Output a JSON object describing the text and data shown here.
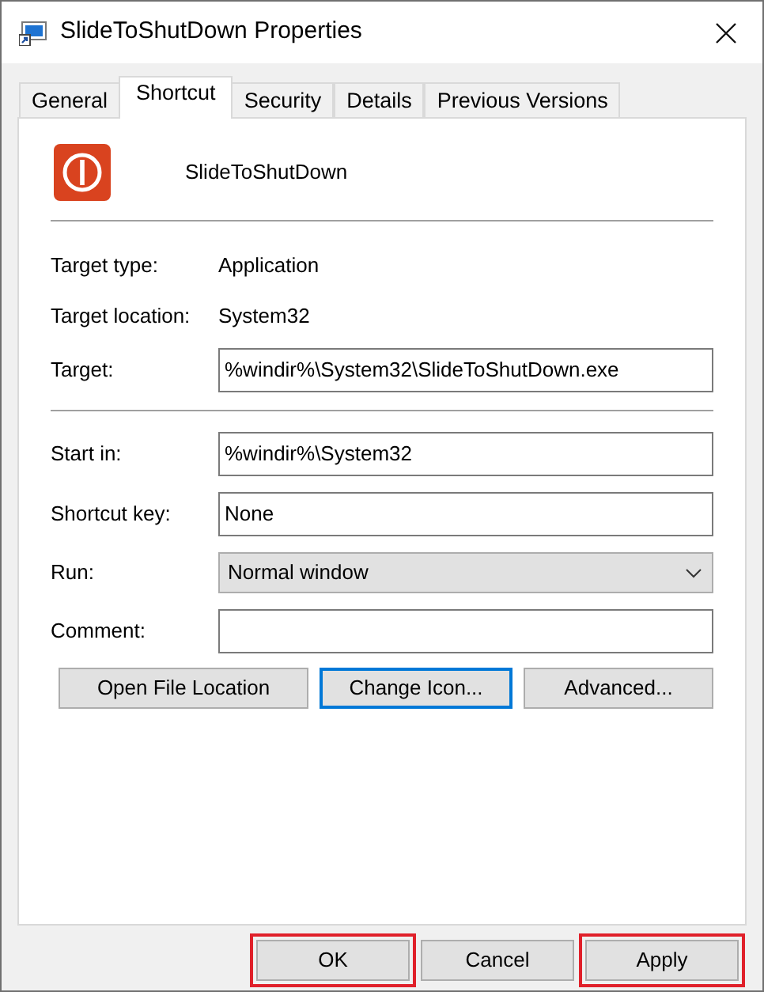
{
  "window": {
    "title": "SlideToShutDown Properties"
  },
  "tabs": [
    {
      "label": "General",
      "selected": false
    },
    {
      "label": "Shortcut",
      "selected": true
    },
    {
      "label": "Security",
      "selected": false
    },
    {
      "label": "Details",
      "selected": false
    },
    {
      "label": "Previous Versions",
      "selected": false
    }
  ],
  "shortcut_name": "SlideToShutDown",
  "info": [
    {
      "label": "Target type:",
      "value": "Application"
    },
    {
      "label": "Target location:",
      "value": "System32"
    }
  ],
  "target": {
    "label": "Target:",
    "value": "%windir%\\System32\\SlideToShutDown.exe"
  },
  "fields": [
    {
      "kind": "text",
      "label": "Start in:",
      "value": "%windir%\\System32"
    },
    {
      "kind": "text",
      "label": "Shortcut key:",
      "value": "None"
    },
    {
      "kind": "dropdown",
      "label": "Run:",
      "value": "Normal window"
    },
    {
      "kind": "text",
      "label": "Comment:"
    }
  ],
  "actions": [
    {
      "label": "Open File Location",
      "focused": false
    },
    {
      "label": "Change Icon...",
      "focused": true
    },
    {
      "label": "Advanced...",
      "focused": false
    }
  ],
  "buttons": [
    {
      "label": "OK",
      "highlighted": true
    },
    {
      "label": "Cancel",
      "highlighted": false
    },
    {
      "label": "Apply",
      "highlighted": true
    }
  ]
}
